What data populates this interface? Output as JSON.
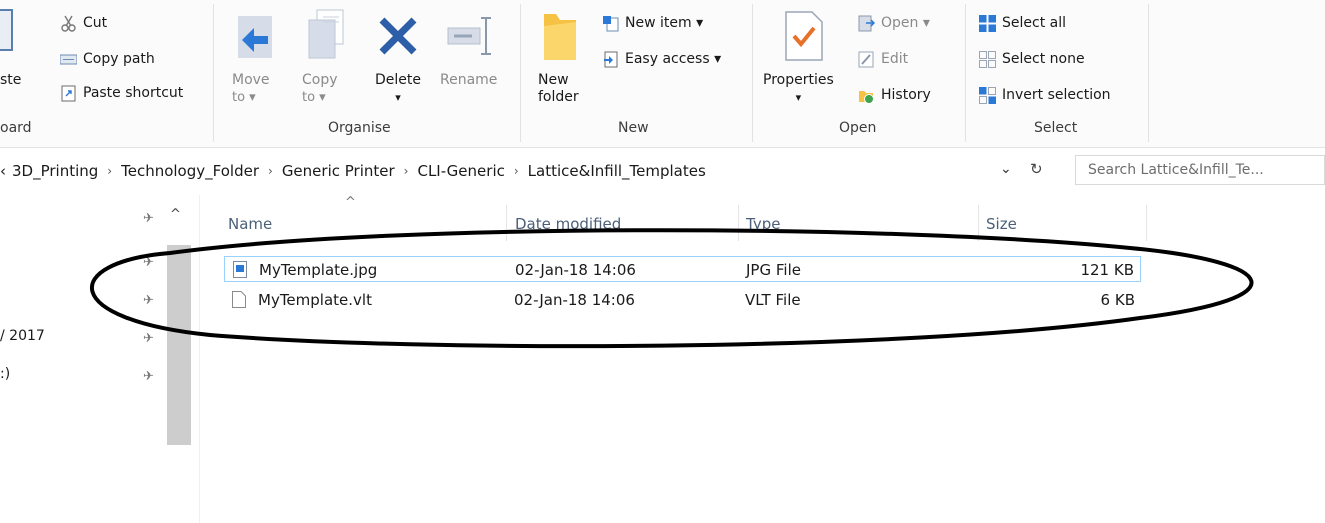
{
  "ribbon": {
    "clipboard": {
      "paste_label": "ste",
      "cut": "Cut",
      "copy_path": "Copy path",
      "paste_shortcut": "Paste shortcut",
      "group": "oard"
    },
    "organise": {
      "move_to": "Move",
      "move_to_2": "to ▾",
      "copy_to": "Copy",
      "copy_to_2": "to ▾",
      "delete": "Delete",
      "delete_arrow": "▾",
      "rename": "Rename",
      "group": "Organise"
    },
    "new": {
      "new_folder": "New",
      "new_folder_2": "folder",
      "new_item": "New item ▾",
      "easy_access": "Easy access ▾",
      "group": "New"
    },
    "open": {
      "properties": "Properties",
      "properties_arrow": "▾",
      "open": "Open ▾",
      "edit": "Edit",
      "history": "History",
      "group": "Open"
    },
    "select": {
      "select_all": "Select all",
      "select_none": "Select none",
      "invert_selection": "Invert selection",
      "group": "Select"
    }
  },
  "address": {
    "crumbs": [
      "‹",
      "3D_Printing",
      "Technology_Folder",
      "Generic Printer",
      "CLI-Generic",
      "Lattice&Infill_Templates"
    ],
    "separator": "›",
    "dropdown": "⌄",
    "refresh": "↻",
    "search_placeholder": "Search Lattice&Infill_Te..."
  },
  "nav": {
    "items": [
      "",
      "",
      "/ 2017",
      ":)"
    ],
    "pin": "✈",
    "scroll_up": "^"
  },
  "filelist": {
    "sort_indicator": "^",
    "columns": {
      "name": "Name",
      "date": "Date modified",
      "type": "Type",
      "size": "Size"
    },
    "rows": [
      {
        "name": "MyTemplate.jpg",
        "date": "02-Jan-18 14:06",
        "type": "JPG File",
        "size": "121 KB"
      },
      {
        "name": "MyTemplate.vlt",
        "date": "02-Jan-18 14:06",
        "type": "VLT File",
        "size": "6 KB"
      }
    ]
  },
  "colors": {
    "accent_blue": "#2b79d7",
    "selection_border": "#99d1ff",
    "header_text": "#4c607a",
    "delete_blue": "#2d5fa8",
    "folder_yellow": "#f5c244",
    "check_orange": "#e8712a"
  }
}
